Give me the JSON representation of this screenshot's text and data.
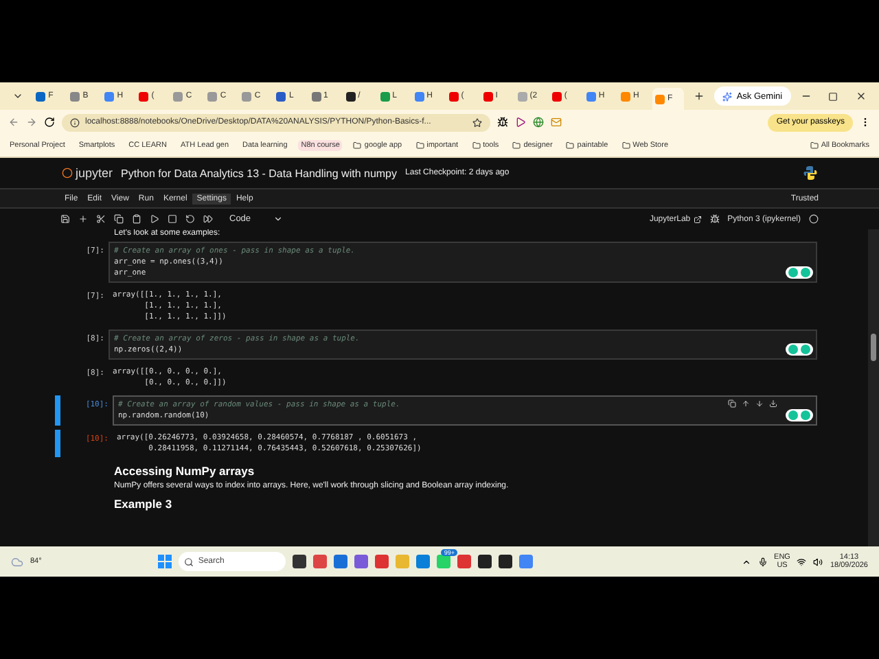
{
  "tabs": [
    {
      "label": "F",
      "selected": false
    },
    {
      "label": "B",
      "selected": false
    },
    {
      "label": "H",
      "selected": false
    },
    {
      "label": "(",
      "selected": false
    },
    {
      "label": "C",
      "selected": false
    },
    {
      "label": "C",
      "selected": false
    },
    {
      "label": "C",
      "selected": false
    },
    {
      "label": "L",
      "selected": false
    },
    {
      "label": "1",
      "selected": false
    },
    {
      "label": "/",
      "selected": false
    },
    {
      "label": "L",
      "selected": false
    },
    {
      "label": "H",
      "selected": false
    },
    {
      "label": "(",
      "selected": false
    },
    {
      "label": "I",
      "selected": false
    },
    {
      "label": "(2",
      "selected": false
    },
    {
      "label": "(",
      "selected": false
    },
    {
      "label": "H",
      "selected": false
    },
    {
      "label": "H",
      "selected": false
    },
    {
      "label": "F",
      "selected": true
    }
  ],
  "ask_gemini": "Ask Gemini",
  "url": "localhost:8888/notebooks/OneDrive/Desktop/DATA%20ANALYSIS/PYTHON/Python-Basics-f...",
  "passkeys": "Get your passkeys",
  "bookmarks": [
    "Personal Project",
    "Smartplots",
    "CC LEARN",
    "ATH Lead gen",
    "Data learning",
    "N8n course"
  ],
  "folders": [
    "google app",
    "important",
    "tools",
    "designer",
    "paintable",
    "Web Store"
  ],
  "all_bookmarks": "All Bookmarks",
  "jupyter": {
    "logo": "jupyter",
    "title": "Python for Data Analytics 13 - Data Handling with numpy",
    "checkpoint": "Last Checkpoint: 2 days ago"
  },
  "menu": [
    {
      "label": "File",
      "selected": false
    },
    {
      "label": "Edit",
      "selected": false
    },
    {
      "label": "View",
      "selected": false
    },
    {
      "label": "Run",
      "selected": false
    },
    {
      "label": "Kernel",
      "selected": false
    },
    {
      "label": "Settings",
      "selected": true
    },
    {
      "label": "Help",
      "selected": false
    }
  ],
  "trusted": "Trusted",
  "cell_type": "Code",
  "jupyterlab": "JupyterLab",
  "kernel": "Python 3 (ipykernel)",
  "cells": [
    {
      "kind": "markdown",
      "text": "Let's look at some examples:"
    },
    {
      "kind": "code",
      "prompt": "[7]:",
      "selected": false,
      "lines": [
        {
          "kind": "comment",
          "text": "# Create an array of ones - pass in shape as a tuple."
        },
        {
          "kind": "code",
          "text": "arr_one = np.ones((3,4))"
        },
        {
          "kind": "code",
          "text": "arr_one"
        }
      ]
    },
    {
      "kind": "output",
      "prompt": "[7]:",
      "selected": false,
      "lines": [
        "array([[1., 1., 1., 1.],",
        "       [1., 1., 1., 1.],",
        "       [1., 1., 1., 1.]])"
      ]
    },
    {
      "kind": "code",
      "prompt": "[8]:",
      "selected": false,
      "lines": [
        {
          "kind": "comment",
          "text": "# Create an array of zeros - pass in shape as a tuple."
        },
        {
          "kind": "code",
          "text": "np.zeros((2,4))"
        }
      ]
    },
    {
      "kind": "output",
      "prompt": "[8]:",
      "selected": false,
      "lines": [
        "array([[0., 0., 0., 0.],",
        "       [0., 0., 0., 0.]])"
      ]
    },
    {
      "kind": "code",
      "prompt": "[10]:",
      "selected": true,
      "lines": [
        {
          "kind": "comment",
          "text": "# Create an array of random values - pass in shape as a tuple."
        },
        {
          "kind": "code",
          "text": "np.random.random(10)"
        }
      ]
    },
    {
      "kind": "output",
      "prompt": "[10]:",
      "selected": true,
      "lines": [
        "array([0.26246773, 0.03924658, 0.28460574, 0.7768187 , 0.6051673 ,",
        "       0.28411958, 0.11271144, 0.76435443, 0.52607618, 0.25307626])"
      ]
    },
    {
      "kind": "heading",
      "text": "Accessing NumPy arrays"
    },
    {
      "kind": "markdown",
      "text": "NumPy offers several ways to index into arrays. Here, we'll work through slicing and Boolean array indexing."
    },
    {
      "kind": "heading",
      "text": "Example 3"
    }
  ],
  "taskbar": {
    "weather": "84°",
    "search": "Search",
    "badge": "99+",
    "lang": "ENG",
    "region": "US",
    "time": "14:13",
    "date": "18/09/2026"
  }
}
